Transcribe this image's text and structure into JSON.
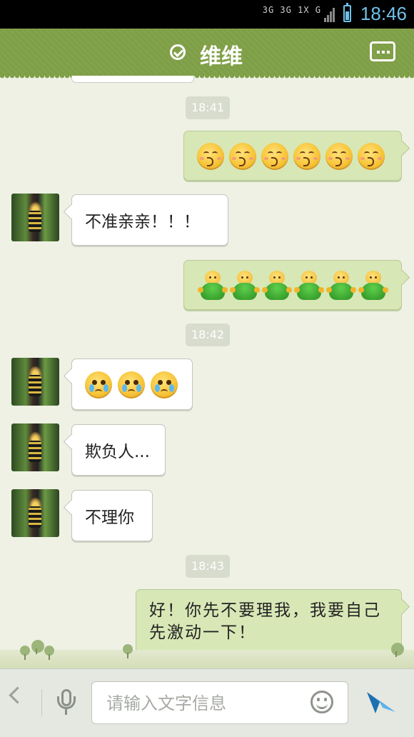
{
  "status_bar": {
    "signal_text": "3G 3G 1X G",
    "time": "18:46"
  },
  "header": {
    "title": "维维",
    "more_icon": "more-dots-icon",
    "status_icon": "check-circle-icon"
  },
  "chat": {
    "timestamps": [
      "18:41",
      "18:42",
      "18:43"
    ],
    "messages": [
      {
        "side": "out",
        "kind": "emoji",
        "emoji": "kiss-emoji",
        "count": 6
      },
      {
        "side": "in",
        "kind": "text",
        "text": "不准亲亲！！！"
      },
      {
        "side": "out",
        "kind": "emoji",
        "emoji": "green-doll-emoji",
        "count": 6
      },
      {
        "side": "in",
        "kind": "emoji",
        "emoji": "crying-emoji",
        "count": 3
      },
      {
        "side": "in",
        "kind": "text",
        "text": "欺负人..."
      },
      {
        "side": "in",
        "kind": "text",
        "text": "不理你"
      },
      {
        "side": "out",
        "kind": "text",
        "text": "好！你先不要理我，我要自己先激动一下！"
      }
    ]
  },
  "input_bar": {
    "placeholder": "请输入文字信息",
    "value": "",
    "back_icon": "chevron-left-icon",
    "voice_icon": "microphone-icon",
    "emoji_icon": "smiley-icon",
    "send_icon": "send-paper-plane-icon"
  },
  "colors": {
    "header": "#7f9f47",
    "chat_bg": "#eef1e3",
    "outgoing_bubble": "#d8e7b6",
    "incoming_bubble": "#ffffff",
    "time_accent": "#6fc0e8"
  }
}
